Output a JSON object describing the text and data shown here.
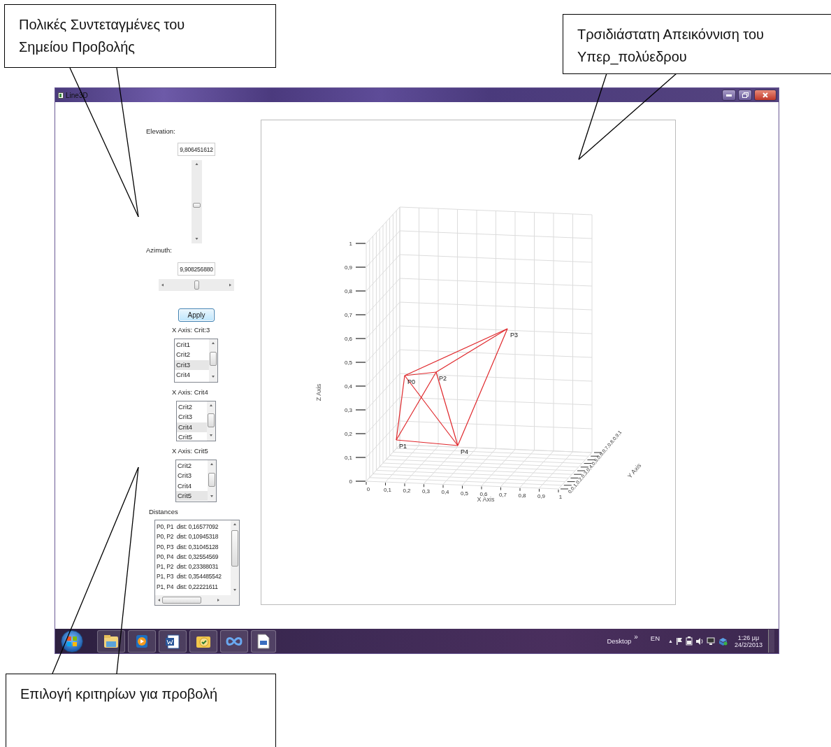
{
  "callouts": [
    {
      "text": "Πολικές Συντεταγμένες του Σημείου Προβολής"
    },
    {
      "text": "Τρσιδιάστατη Απεικόννιση του Υπερ_πολύεδρου"
    },
    {
      "text": "Επιλογή κριτηρίων για προβολή"
    }
  ],
  "window": {
    "title": "Line3D"
  },
  "elevation": {
    "label": "Elevation:",
    "value": "9,806451612"
  },
  "azimuth": {
    "label": "Azimuth:",
    "value": "9,908256880",
    "level": 0.5
  },
  "apply_button": "Apply",
  "axis_lists": [
    {
      "label": "X Axis: Crit:3",
      "items": [
        {
          "text": "Crit1",
          "selected": false
        },
        {
          "text": "Crit2",
          "selected": false
        },
        {
          "text": "Crit3",
          "selected": true
        },
        {
          "text": "Crit4",
          "selected": false
        }
      ]
    },
    {
      "label": "X Axis: Crit4",
      "items": [
        {
          "text": "Crit2",
          "selected": false
        },
        {
          "text": "Crit3",
          "selected": false
        },
        {
          "text": "Crit4",
          "selected": true
        },
        {
          "text": "Crit5",
          "selected": false
        }
      ]
    },
    {
      "label": "X Axis: Crit5",
      "items": [
        {
          "text": "Crit2",
          "selected": false
        },
        {
          "text": "Crit3",
          "selected": false
        },
        {
          "text": "Crit4",
          "selected": false
        },
        {
          "text": "Crit5",
          "selected": true
        }
      ]
    }
  ],
  "distances": {
    "label": "Distances",
    "rows": [
      "P0, P1  dist: 0,16577092",
      "P0, P2  dist: 0,10945318",
      "P0, P3  dist: 0,31045128",
      "P0, P4  dist: 0,32554569",
      "P1, P2  dist: 0,23388031",
      "P1, P3  dist: 0,354485542",
      "P1, P4  dist: 0,22221611"
    ]
  },
  "plot": {
    "z_axis_title": "Z Axis",
    "x_axis_title": "X Axis",
    "y_axis_title": "Y Axis",
    "z_ticks": [
      "1",
      "0,9",
      "0,8",
      "0,7",
      "0,6",
      "0,5",
      "0,4",
      "0,3",
      "0,2",
      "0,1",
      "0"
    ],
    "x_ticks": [
      "0",
      "0,1",
      "0,2",
      "0,3",
      "0,4",
      "0,5",
      "0,6",
      "0,7",
      "0,8",
      "0,9",
      "1"
    ],
    "y_ticks": "0,0,1,0,2,0,3,0,4,0,5,0,6,0,7,0,8,0,9,1",
    "points": [
      {
        "label": "P0"
      },
      {
        "label": "P1"
      },
      {
        "label": "P2"
      },
      {
        "label": "P3"
      },
      {
        "label": "P4"
      }
    ]
  },
  "taskbar": {
    "toolbar_label": "Desktop",
    "chevron": "»",
    "language": "EN",
    "tray_arrow": "▲",
    "time": "1:26 μμ",
    "date": "24/2/2013"
  }
}
